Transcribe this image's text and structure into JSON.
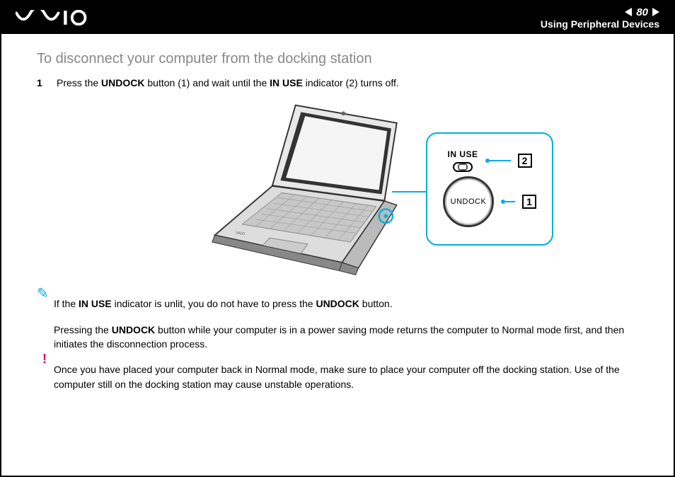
{
  "header": {
    "page_num": "80",
    "section": "Using Peripheral Devices"
  },
  "title": "To disconnect your computer from the docking station",
  "step1": {
    "num": "1",
    "text_before": "Press the ",
    "b1": "UNDOCK",
    "text_mid1": " button (1) and wait until the ",
    "b2": "IN USE",
    "text_after": " indicator (2) turns off."
  },
  "callout": {
    "in_use_label": "IN USE",
    "undock_label": "UNDOCK",
    "ref1": "1",
    "ref2": "2"
  },
  "note1": {
    "t1": "If the ",
    "b1": "IN USE",
    "t2": " indicator is unlit, you do not have to press the ",
    "b2": "UNDOCK",
    "t3": " button."
  },
  "note2": {
    "t1": "Pressing the ",
    "b1": "UNDOCK",
    "t2": " button while your computer is in a power saving mode returns the computer to Normal mode first, and then initiates the disconnection process."
  },
  "warning": {
    "text": "Once you have placed your computer back in Normal mode, make sure to place your computer off the docking station. Use of the computer still on the docking station may cause unstable operations."
  }
}
